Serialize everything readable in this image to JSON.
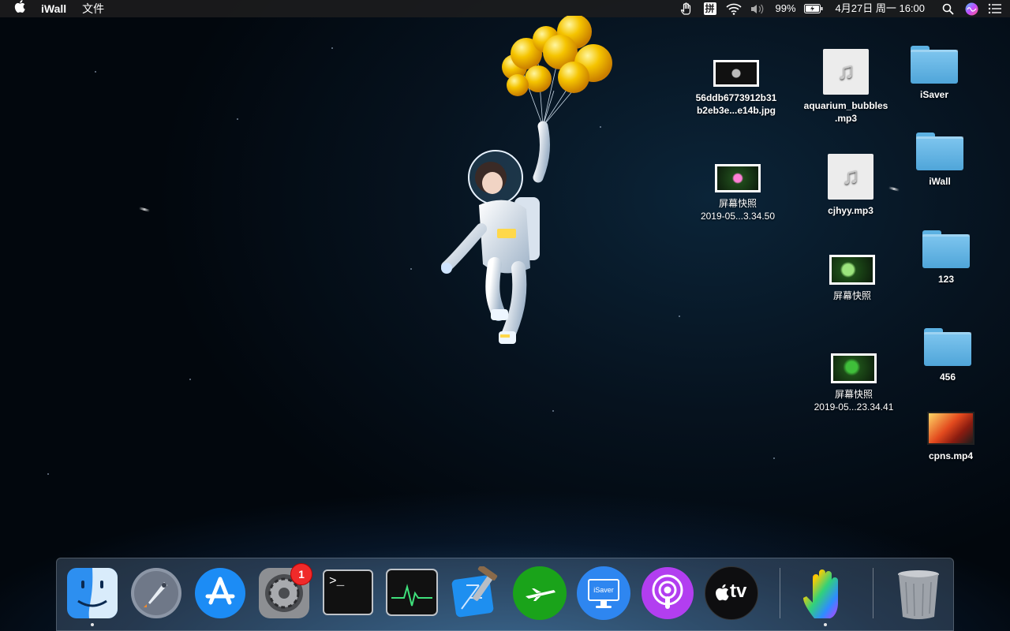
{
  "menubar": {
    "apple_icon": "apple-logo",
    "app_name": "iWall",
    "menu_file": "文件",
    "battery_percent": "99%",
    "datetime": "4月27日 周一  16:00",
    "status_icons": [
      "hand-icon",
      "pinyin-input-icon",
      "wifi-icon",
      "volume-icon",
      "battery-icon",
      "search-icon",
      "siri-icon",
      "notification-center-icon"
    ],
    "input_method_glyph": "拼"
  },
  "desktop": {
    "files": [
      {
        "label": "56ddb6773912b31\nb2eb3e...e14b.jpg",
        "kind": "image"
      },
      {
        "label": "aquarium_bubbles\n.mp3",
        "kind": "audio"
      },
      {
        "label": "iSaver",
        "kind": "folder"
      },
      {
        "label": "iWall",
        "kind": "folder"
      },
      {
        "label": "屏幕快照\n2019-05...3.34.50",
        "kind": "image"
      },
      {
        "label": "cjhyy.mp3",
        "kind": "audio"
      },
      {
        "label": "123",
        "kind": "folder"
      },
      {
        "label": "屏幕快照",
        "kind": "image"
      },
      {
        "label": "456",
        "kind": "folder"
      },
      {
        "label": "屏幕快照\n2019-05...23.34.41",
        "kind": "image"
      },
      {
        "label": "cpns.mp4",
        "kind": "video"
      }
    ]
  },
  "dock": {
    "apps": [
      {
        "name": "finder-icon",
        "running": true
      },
      {
        "name": "launchpad-icon",
        "running": false
      },
      {
        "name": "app-store-icon",
        "running": false
      },
      {
        "name": "system-preferences-icon",
        "running": false,
        "badge": "1"
      },
      {
        "name": "terminal-icon",
        "running": false
      },
      {
        "name": "activity-monitor-icon",
        "running": false
      },
      {
        "name": "xcode-icon",
        "running": false
      },
      {
        "name": "airplane-app-icon",
        "running": false
      },
      {
        "name": "isaver-icon",
        "running": false
      },
      {
        "name": "podcasts-icon",
        "running": false
      },
      {
        "name": "apple-tv-icon",
        "running": false
      },
      {
        "name": "iwall-hand-icon",
        "running": true
      },
      {
        "name": "trash-icon",
        "running": false
      }
    ],
    "terminal_prompt": ">_",
    "isaver_label": "iSaver",
    "tv_label": "tv",
    "system_prefs_badge": "1"
  }
}
